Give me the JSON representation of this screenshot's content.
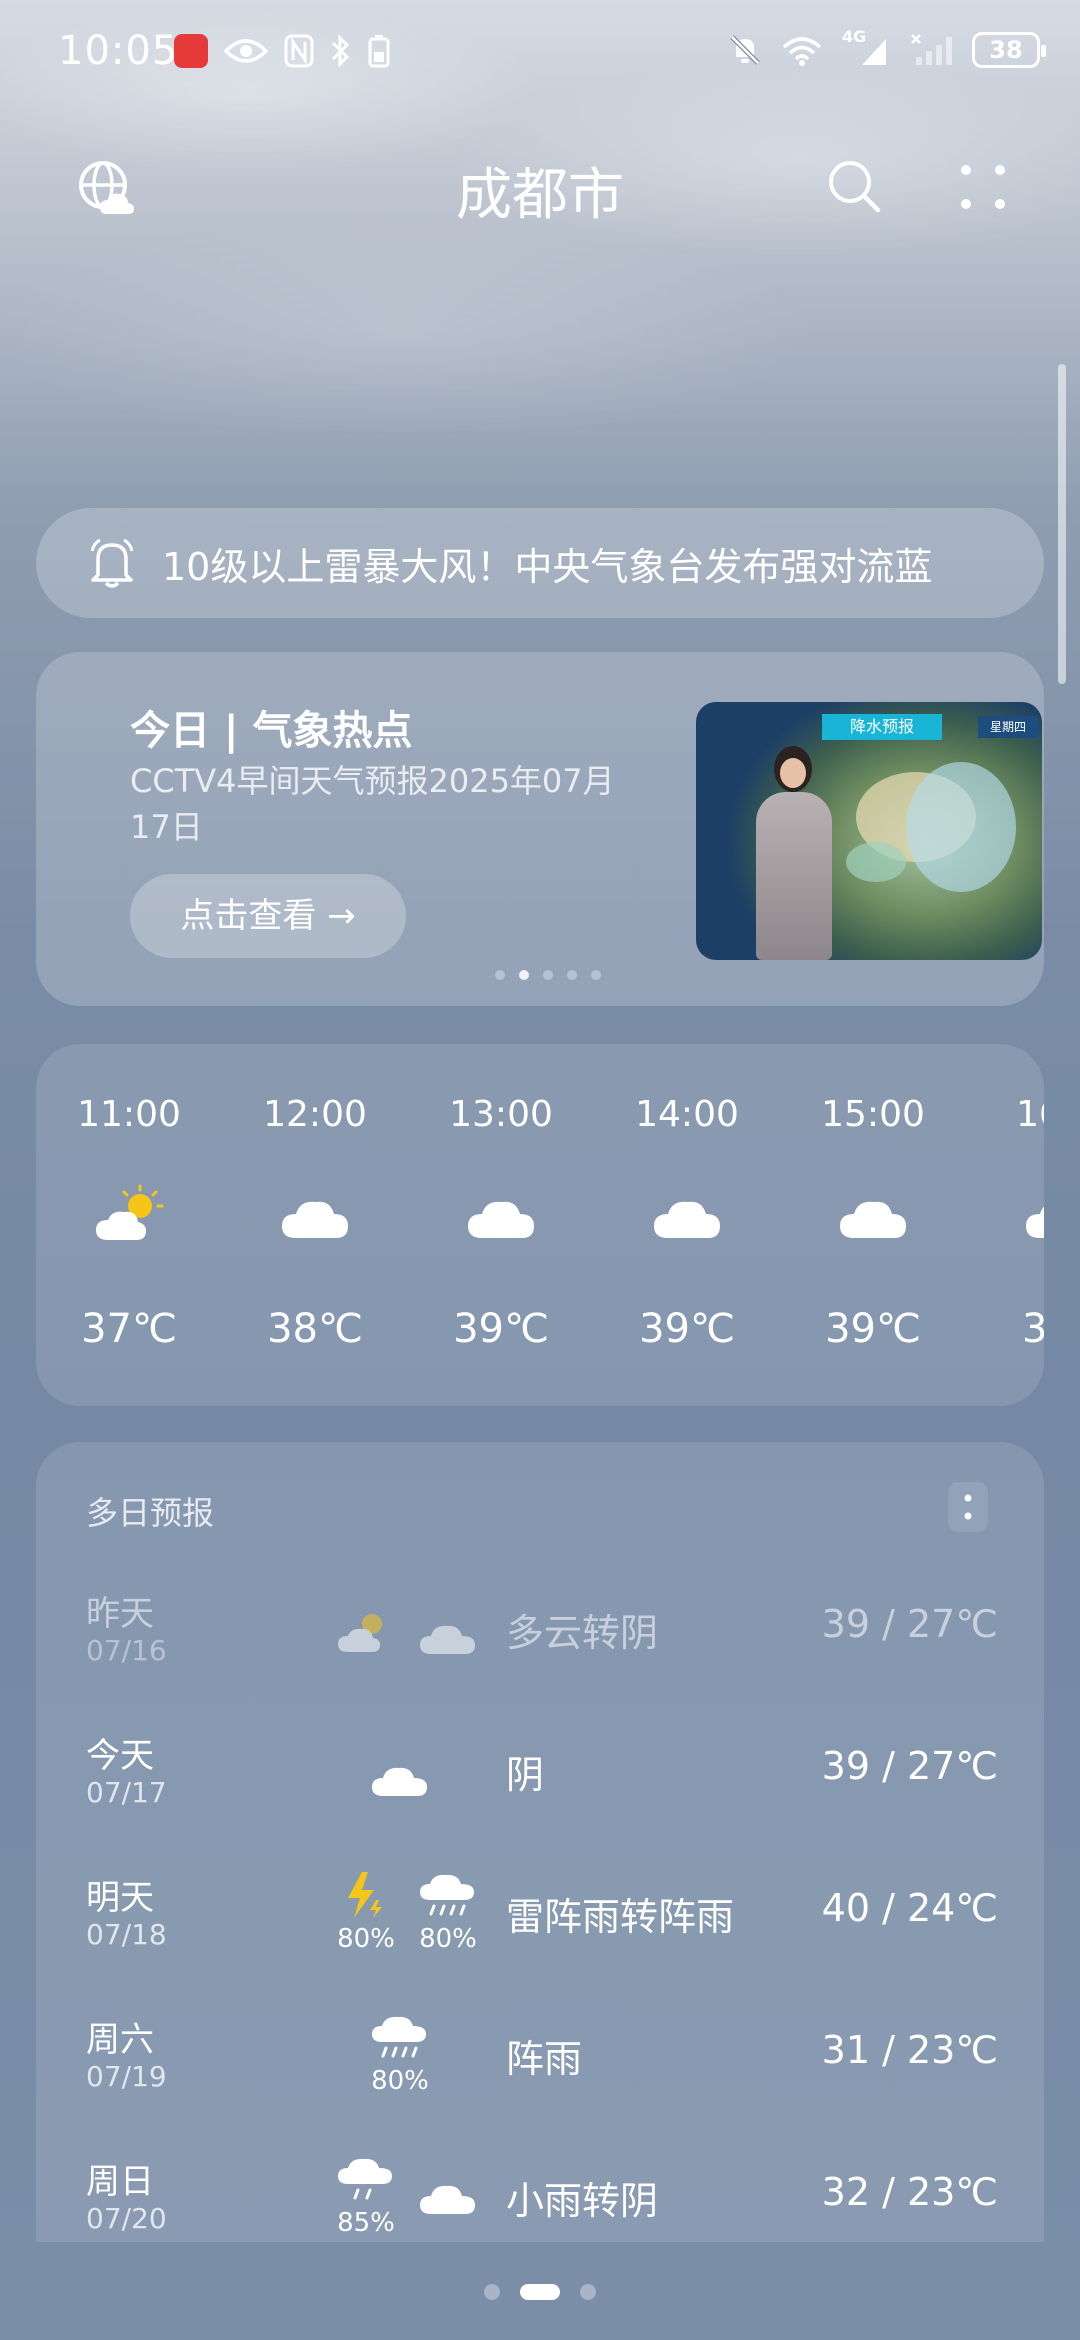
{
  "status_bar": {
    "time": "10:05",
    "battery": "38",
    "network_label": "4G",
    "icons": [
      "app-badge-icon",
      "eye-icon",
      "nfc-icon",
      "bluetooth-icon",
      "mute-icon",
      "wifi-icon",
      "signal-icon",
      "no-signal-icon"
    ]
  },
  "header": {
    "city": "成都市",
    "left_icon": "globe-weather-icon",
    "right_icons": [
      "search-icon",
      "more-icon"
    ]
  },
  "alert": {
    "icon": "bell-icon",
    "text": "10级以上雷暴大风！中央气象台发布强对流蓝"
  },
  "hot_card": {
    "title": "今日 | 气象热点",
    "subtitle": "CCTV4早间天气预报2025年07月17日",
    "button": "点击查看 →",
    "thumbnail": {
      "banner": "降水预报",
      "tag": "星期四"
    },
    "dots_count": 5,
    "active_dot": 1
  },
  "hourly": [
    {
      "time": "11:00",
      "icon": "sun-cloud-icon",
      "temp": "37℃"
    },
    {
      "time": "12:00",
      "icon": "cloud-icon",
      "temp": "38℃"
    },
    {
      "time": "13:00",
      "icon": "cloud-icon",
      "temp": "39℃"
    },
    {
      "time": "14:00",
      "icon": "cloud-icon",
      "temp": "39℃"
    },
    {
      "time": "15:00",
      "icon": "cloud-icon",
      "temp": "39℃"
    },
    {
      "time": "16",
      "icon": "cloud-icon",
      "temp": "3"
    }
  ],
  "daily": {
    "title": "多日预报",
    "days": [
      {
        "name": "昨天",
        "date": "07/16",
        "icons": [
          "sun-cloud-icon",
          "cloud-icon"
        ],
        "pcts": [
          "",
          ""
        ],
        "desc": "多云转阴",
        "temp": "39 / 27℃",
        "dim": true
      },
      {
        "name": "今天",
        "date": "07/17",
        "icons": [
          "cloud-icon"
        ],
        "pcts": [
          ""
        ],
        "desc": "阴",
        "temp": "39 / 27℃",
        "dim": false
      },
      {
        "name": "明天",
        "date": "07/18",
        "icons": [
          "thunder-icon",
          "rain-cloud-icon"
        ],
        "pcts": [
          "80%",
          "80%"
        ],
        "desc": "雷阵雨转阵雨",
        "temp": "40 / 24℃",
        "dim": false
      },
      {
        "name": "周六",
        "date": "07/19",
        "icons": [
          "rain-cloud-icon"
        ],
        "pcts": [
          "80%"
        ],
        "desc": "阵雨",
        "temp": "31 / 23℃",
        "dim": false
      },
      {
        "name": "周日",
        "date": "07/20",
        "icons": [
          "light-rain-icon",
          "cloud-icon"
        ],
        "pcts": [
          "85%",
          ""
        ],
        "desc": "小雨转阴",
        "temp": "32 / 23℃",
        "dim": false
      }
    ]
  },
  "page_indicator": {
    "count": 3,
    "active": 1
  }
}
